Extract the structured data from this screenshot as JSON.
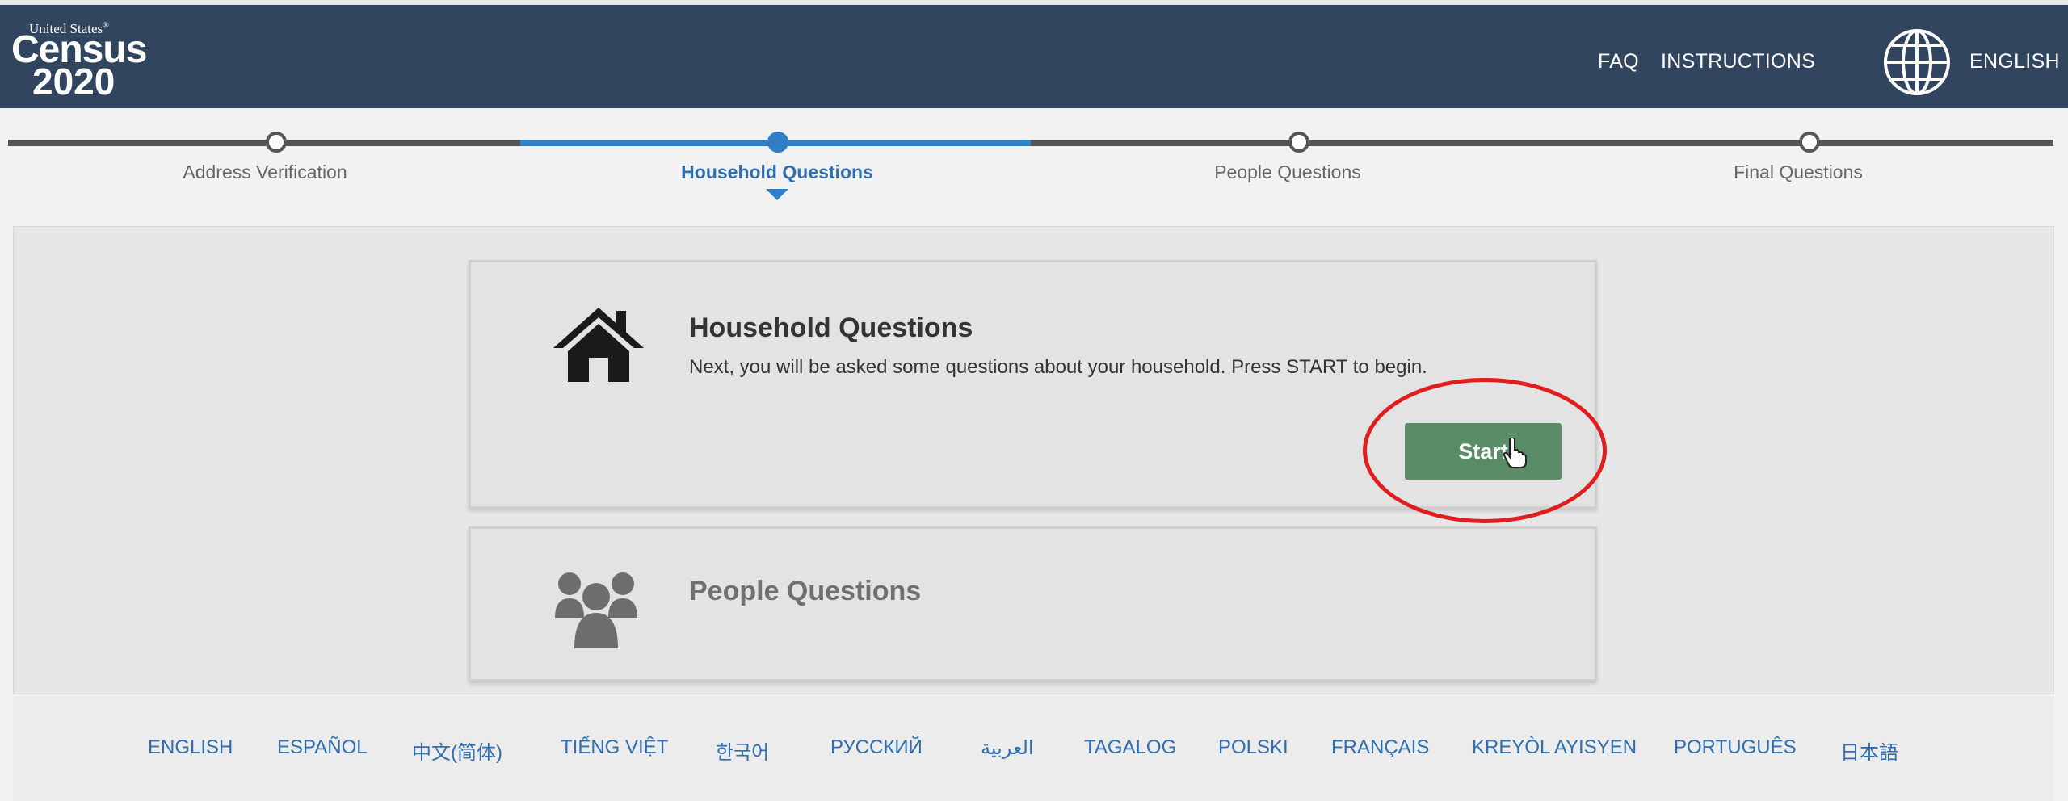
{
  "header": {
    "logo_top": "United States",
    "logo_reg": "®",
    "logo_main": "Census",
    "logo_year": "2020",
    "faq_label": "FAQ",
    "instructions_label": "INSTRUCTIONS",
    "language_label": "ENGLISH"
  },
  "progress": {
    "steps": [
      {
        "label": "Address Verification",
        "state": "complete"
      },
      {
        "label": "Household Questions",
        "state": "active"
      },
      {
        "label": "People Questions",
        "state": "upcoming"
      },
      {
        "label": "Final Questions",
        "state": "upcoming"
      }
    ]
  },
  "cards": {
    "household": {
      "title": "Household Questions",
      "description": "Next, you will be asked some questions about your household. Press START to begin.",
      "button_label": "Start",
      "icon": "house-icon"
    },
    "people": {
      "title": "People Questions",
      "icon": "people-group-icon"
    }
  },
  "footer": {
    "languages": [
      "ENGLISH",
      "ESPAÑOL",
      "中文(简体)",
      "TIẾNG VIỆT",
      "한국어",
      "РУССКИЙ",
      "العربية",
      "TAGALOG",
      "POLSKI",
      "FRANÇAIS",
      "KREYÒL AYISYEN",
      "PORTUGUÊS",
      "日本語"
    ]
  },
  "colors": {
    "header_bg": "#31455f",
    "active_step": "#2f7ec6",
    "start_button": "#5a8c67",
    "highlight_ring": "#e11d1d",
    "link": "#2f6eb0"
  }
}
